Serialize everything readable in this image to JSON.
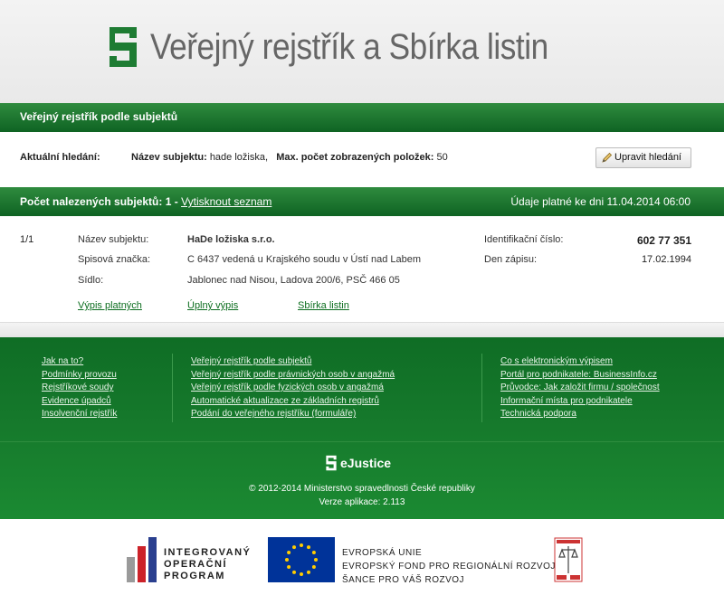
{
  "header": {
    "title": "Veřejný rejstřík a Sbírka listin"
  },
  "section": {
    "title": "Veřejný rejstřík podle subjektů"
  },
  "search": {
    "current_label": "Aktuální hledání:",
    "name_label": "Název subjektu:",
    "name_value": "hade ložiska,",
    "max_label": "Max. počet zobrazených položek:",
    "max_value": "50",
    "edit_button": "Upravit hledání"
  },
  "results_bar": {
    "count_label": "Počet nalezených subjektů: 1",
    "separator": "-",
    "print_link": "Vytisknout seznam",
    "valid_text": "Údaje platné ke dni 11.04.2014 06:00"
  },
  "result": {
    "position": "1/1",
    "name_label": "Název subjektu:",
    "name_value": "HaDe ložiska s.r.o.",
    "file_label": "Spisová značka:",
    "file_value": "C 6437 vedená u Krajského soudu v Ústí nad Labem",
    "seat_label": "Sídlo:",
    "seat_value": "Jablonec nad Nisou, Ladova 200/6, PSČ 466 05",
    "id_label": "Identifikační číslo:",
    "id_value": "602 77 351",
    "date_label": "Den zápisu:",
    "date_value": "17.02.1994",
    "links": [
      "Výpis platných",
      "Úplný výpis",
      "Sbírka listin"
    ]
  },
  "footer": {
    "col1": [
      "Jak na to?",
      "Podmínky provozu",
      "Rejstříkové soudy",
      "Evidence úpadců",
      "Insolvenční rejstřík"
    ],
    "col2": [
      "Veřejný rejstřík podle subjektů",
      "Veřejný rejstřík podle právnických osob v angažmá",
      "Veřejný rejstřík podle fyzických osob v angažmá",
      "Automatické aktualizace ze základních registrů",
      "Podání do veřejného rejstříku (formuláře)"
    ],
    "col3": [
      "Co s elektronickým výpisem",
      "Portál pro podnikatele: BusinessInfo.cz",
      "Průvodce: Jak založit firmu / společnost",
      "Informační místa pro podnikatele",
      "Technická podpora"
    ],
    "brand": "eJustice",
    "copyright": "© 2012-2014 Ministerstvo spravedlnosti České republiky",
    "version": "Verze aplikace: 2.113"
  },
  "logos": {
    "iop_lines": [
      "INTEGROVANÝ",
      "OPERAČNÍ",
      "PROGRAM"
    ],
    "eu_lines": [
      "EVROPSKÁ UNIE",
      "EVROPSKÝ FOND PRO REGIONÁLNÍ ROZVOJ",
      "ŠANCE PRO VÁŠ ROZVOJ"
    ]
  },
  "colors": {
    "green_dark": "#0f6323",
    "green_light": "#2f8b3e",
    "link_green": "#0b6d1e",
    "eu_blue": "#003399"
  }
}
